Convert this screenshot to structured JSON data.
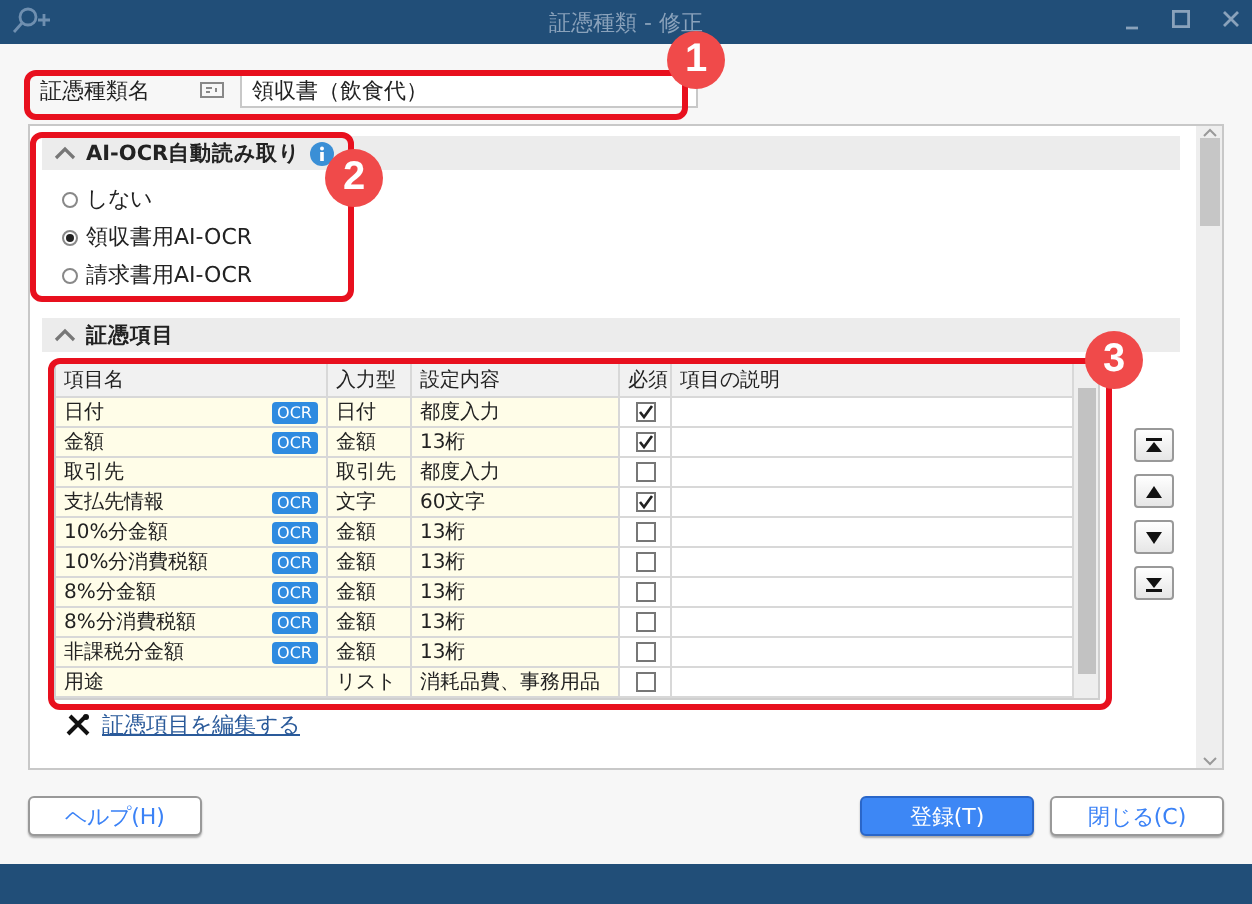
{
  "window": {
    "title": "証憑種類 - 修正"
  },
  "name_field": {
    "label": "証憑種類名",
    "value": "領収書（飲食代）"
  },
  "ocr_section": {
    "title": "AI-OCR自動読み取り",
    "expanded": true,
    "options": [
      {
        "label": "しない",
        "selected": false
      },
      {
        "label": "領収書用AI-OCR",
        "selected": true
      },
      {
        "label": "請求書用AI-OCR",
        "selected": false
      }
    ]
  },
  "items_section": {
    "title": "証憑項目",
    "expanded": true,
    "table": {
      "columns": [
        "項目名",
        "入力型",
        "設定内容",
        "必須",
        "項目の説明"
      ],
      "rows": [
        {
          "name": "日付",
          "ocr": "OCR",
          "type": "日付",
          "setting": "都度入力",
          "required": true
        },
        {
          "name": "金額",
          "ocr": "OCR",
          "type": "金額",
          "setting": "13桁",
          "required": true
        },
        {
          "name": "取引先",
          "type": "取引先",
          "setting": "都度入力",
          "required": false
        },
        {
          "name": "支払先情報",
          "ocr": "OCR",
          "type": "文字",
          "setting": "60文字",
          "required": true
        },
        {
          "name": "10%分金額",
          "ocr": "OCR",
          "type": "金額",
          "setting": "13桁",
          "required": false
        },
        {
          "name": "10%分消費税額",
          "ocr": "OCR",
          "type": "金額",
          "setting": "13桁",
          "required": false
        },
        {
          "name": "8%分金額",
          "ocr": "OCR",
          "type": "金額",
          "setting": "13桁",
          "required": false
        },
        {
          "name": "8%分消費税額",
          "ocr": "OCR",
          "type": "金額",
          "setting": "13桁",
          "required": false
        },
        {
          "name": "非課税分金額",
          "ocr": "OCR",
          "type": "金額",
          "setting": "13桁",
          "required": false
        },
        {
          "name": "用途",
          "type": "リスト",
          "setting": "消耗品費、事務用品",
          "required": false
        }
      ]
    },
    "edit_link": "証憑項目を編集する"
  },
  "buttons": [
    {
      "label": "ヘルプ(H)",
      "kind": "plain"
    },
    {
      "label": "登録(T)",
      "kind": "primary"
    },
    {
      "label": "閉じる(C)",
      "kind": "plain"
    }
  ],
  "callouts": [
    {
      "number": "1"
    },
    {
      "number": "2"
    },
    {
      "number": "3"
    }
  ]
}
